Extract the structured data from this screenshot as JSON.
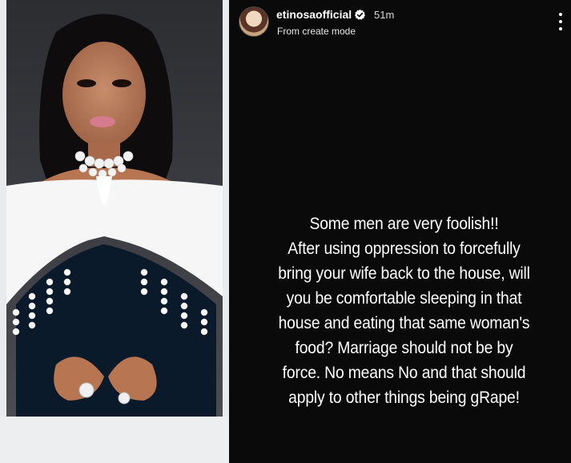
{
  "story": {
    "username": "etinosaofficial",
    "time": "51m",
    "subtitle": "From create mode",
    "lines": [
      "Some men are very foolish!!",
      "After using oppression to forcefully",
      "bring your wife back to the house, will",
      "you be comfortable sleeping in that",
      "house and eating that same woman's",
      "food? Marriage should not be by",
      "force. No means No and that should",
      "apply to other things being gRape!"
    ]
  },
  "colors": {
    "story_background": "#0a0a0a",
    "verified_badge": "#ffffff",
    "text": "#ffffff"
  },
  "icons": [
    "verified-badge-icon",
    "more-options-icon"
  ]
}
